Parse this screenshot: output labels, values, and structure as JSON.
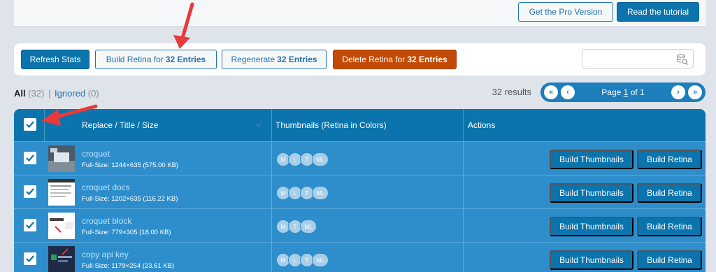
{
  "header": {
    "pro_button": "Get the Pro Version",
    "tutorial_button": "Read the tutorial"
  },
  "toolbar": {
    "refresh_label": "Refresh Stats",
    "build_retina_prefix": "Build Retina for",
    "build_retina_count": "32 Entries",
    "regenerate_prefix": "Regenerate",
    "regenerate_count": "32 Entries",
    "delete_prefix": "Delete Retina for",
    "delete_count": "32 Entries",
    "search_placeholder": ""
  },
  "filters": {
    "all_label": "All",
    "all_count": "(32)",
    "separator": "|",
    "ignored_label": "Ignored",
    "ignored_count": "(0)"
  },
  "pagination": {
    "results": "32 results",
    "page_prefix": "Page",
    "page_current": "1",
    "page_suffix": "of 1"
  },
  "table": {
    "headers": {
      "title": "Replace / Title / Size",
      "thumbnails": "Thumbnails (Retina in Colors)",
      "actions": "Actions"
    },
    "rows": [
      {
        "title": "croquet",
        "size": "Full-Size: 1244×635 (575.00 KB)",
        "bubbles": [
          "M",
          "L",
          "T",
          "ML"
        ],
        "action1": "Build Thumbnails",
        "action2": "Build Retina"
      },
      {
        "title": "croquet docs",
        "size": "Full-Size: 1202×635 (116.22 KB)",
        "bubbles": [
          "M",
          "L",
          "T",
          "ML"
        ],
        "action1": "Build Thumbnails",
        "action2": "Build Retina"
      },
      {
        "title": "croquet block",
        "size": "Full-Size: 779×305 (18.00 KB)",
        "bubbles": [
          "M",
          "T",
          "ML"
        ],
        "action1": "Build Thumbnails",
        "action2": "Build Retina"
      },
      {
        "title": "copy api key",
        "size": "Full-Size: 1179×254 (23.61 KB)",
        "bubbles": [
          "M",
          "L",
          "T",
          "ML"
        ],
        "action1": "Build Thumbnails",
        "action2": "Build Retina"
      }
    ]
  },
  "colors": {
    "accent": "#0b74ad",
    "danger": "#c24a04",
    "annotation_arrow": "#e8393b"
  }
}
